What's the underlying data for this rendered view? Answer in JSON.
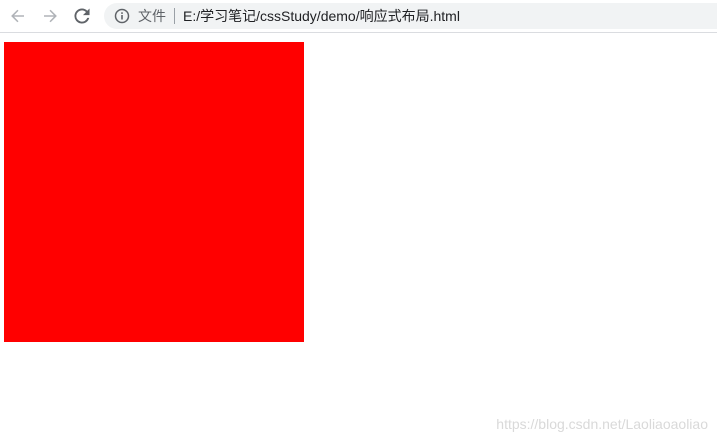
{
  "browser": {
    "security_label": "文件",
    "url": "E:/学习笔记/cssStudy/demo/响应式布局.html",
    "icons": {
      "back": "arrow-left-icon",
      "forward": "arrow-right-icon",
      "reload": "reload-icon",
      "info": "info-icon"
    }
  },
  "page": {
    "box_color": "#ff0000"
  },
  "watermark": {
    "text": "https://blog.csdn.net/Laoliaoaoliao"
  }
}
